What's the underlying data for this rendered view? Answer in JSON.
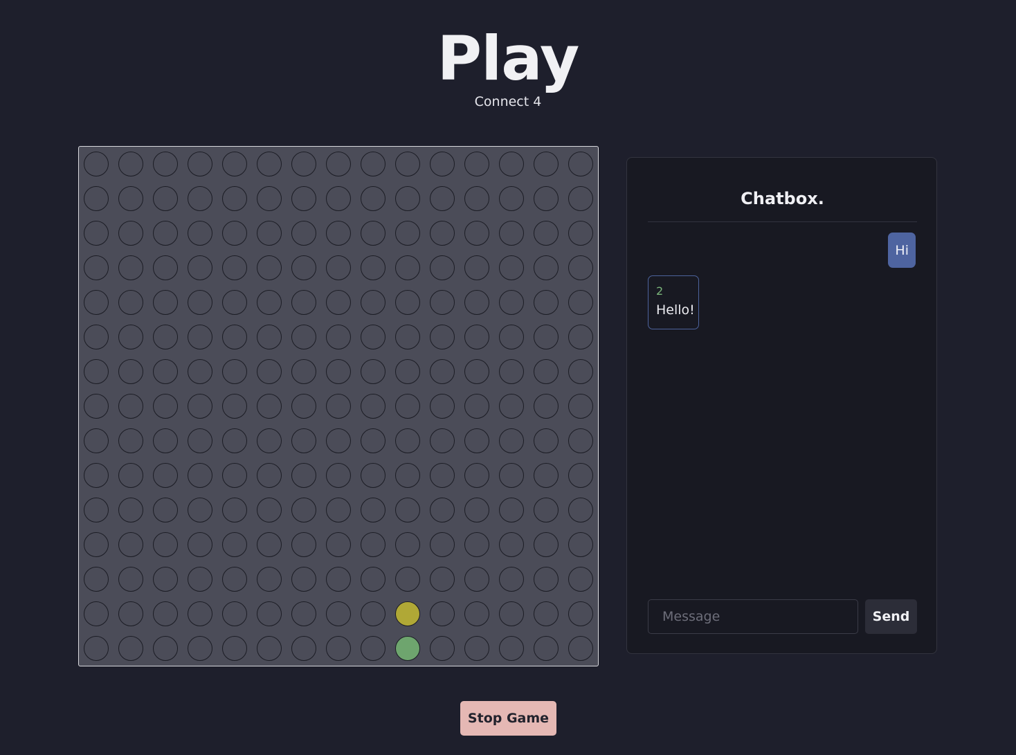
{
  "header": {
    "title": "Play",
    "subtitle": "Connect 4"
  },
  "board": {
    "rows": 15,
    "columns": 15,
    "empty_color": "#4b4c58",
    "player_colors": {
      "1": "#6ea56e",
      "2": "#b0a836"
    },
    "pieces": [
      {
        "row": 14,
        "col": 9,
        "player": 1
      },
      {
        "row": 13,
        "col": 9,
        "player": 2
      }
    ]
  },
  "chat": {
    "title": "Chatbox.",
    "messages": [
      {
        "direction": "outgoing",
        "text": "Hi"
      },
      {
        "direction": "incoming",
        "sender": "2",
        "text": "Hello!"
      }
    ],
    "input": {
      "value": "",
      "placeholder": "Message"
    },
    "send_label": "Send"
  },
  "actions": {
    "stop_label": "Stop Game"
  }
}
